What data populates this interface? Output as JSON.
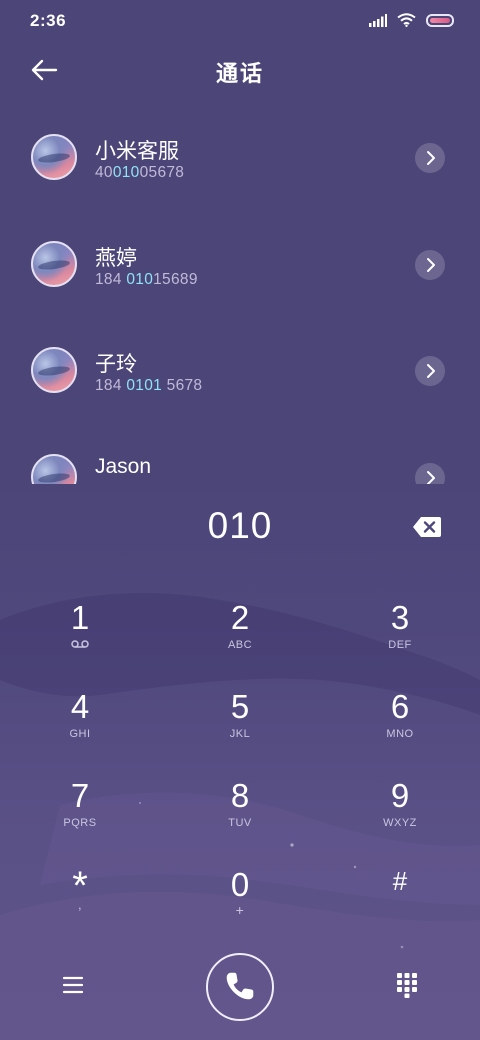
{
  "status_bar": {
    "time": "2:36",
    "battery_percent": 100
  },
  "header": {
    "title": "通话"
  },
  "contacts": [
    {
      "name": "小米客服",
      "number_pre": "40",
      "number_match": "010",
      "number_post": "05678"
    },
    {
      "name": "燕婷",
      "number_pre": "184 ",
      "number_match": "010",
      "number_post": "15689"
    },
    {
      "name": "子玲",
      "number_pre": "184 ",
      "number_match": "0101",
      "number_post": " 5678"
    },
    {
      "name": "Jason",
      "number_pre": "",
      "number_match": "",
      "number_post": ""
    }
  ],
  "dialer": {
    "input": "010"
  },
  "keypad": [
    {
      "digit": "1",
      "letters": ""
    },
    {
      "digit": "2",
      "letters": "ABC"
    },
    {
      "digit": "3",
      "letters": "DEF"
    },
    {
      "digit": "4",
      "letters": "GHI"
    },
    {
      "digit": "5",
      "letters": "JKL"
    },
    {
      "digit": "6",
      "letters": "MNO"
    },
    {
      "digit": "7",
      "letters": "PQRS"
    },
    {
      "digit": "8",
      "letters": "TUV"
    },
    {
      "digit": "9",
      "letters": "WXYZ"
    },
    {
      "digit": "*",
      "letters": ","
    },
    {
      "digit": "0",
      "letters": "+"
    },
    {
      "digit": "#",
      "letters": ""
    }
  ],
  "icons": {
    "back": "arrow-left-icon",
    "chevron": "chevron-right-icon",
    "backspace": "backspace-icon",
    "voicemail": "voicemail-icon",
    "menu": "menu-icon",
    "call": "phone-icon",
    "dialpad": "dialpad-icon"
  },
  "colors": {
    "background": "#4c4577",
    "match_highlight": "#8fe3f3",
    "secondary_text": "#c0bad8"
  }
}
